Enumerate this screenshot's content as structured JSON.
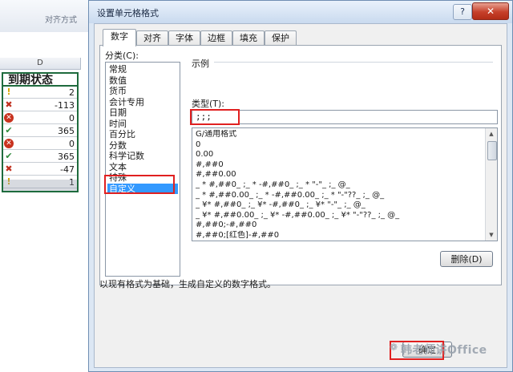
{
  "ribbon": {
    "group_label": "对齐方式"
  },
  "spreadsheet": {
    "column_label": "D",
    "header_cell": "到期状态",
    "rows": [
      {
        "icon": "warning-flag-icon",
        "glyph": "!",
        "value": "2"
      },
      {
        "icon": "red-cross-icon",
        "glyph": "✖",
        "value": "-113"
      },
      {
        "icon": "stop-circle-icon",
        "glyph": "✕",
        "value": "0"
      },
      {
        "icon": "green-check-icon",
        "glyph": "✔",
        "value": "365"
      },
      {
        "icon": "stop-circle-icon",
        "glyph": "✕",
        "value": "0"
      },
      {
        "icon": "green-check-icon",
        "glyph": "✔",
        "value": "365"
      },
      {
        "icon": "red-cross-icon",
        "glyph": "✖",
        "value": "-47"
      },
      {
        "icon": "warning-flag-icon",
        "glyph": "!",
        "value": "1"
      }
    ]
  },
  "dialog": {
    "title": "设置单元格格式",
    "help_label": "?",
    "close_label": "✕",
    "tabs": [
      {
        "label": "数字",
        "active": true
      },
      {
        "label": "对齐",
        "active": false
      },
      {
        "label": "字体",
        "active": false
      },
      {
        "label": "边框",
        "active": false
      },
      {
        "label": "填充",
        "active": false
      },
      {
        "label": "保护",
        "active": false
      }
    ],
    "category_label": "分类(C):",
    "categories": [
      {
        "label": "常规"
      },
      {
        "label": "数值"
      },
      {
        "label": "货币"
      },
      {
        "label": "会计专用"
      },
      {
        "label": "日期"
      },
      {
        "label": "时间"
      },
      {
        "label": "百分比"
      },
      {
        "label": "分数"
      },
      {
        "label": "科学记数"
      },
      {
        "label": "文本"
      },
      {
        "label": "特殊"
      },
      {
        "label": "自定义",
        "selected": true
      }
    ],
    "sample_label": "示例",
    "type_label": "类型(T):",
    "type_value": ";;;",
    "formats": [
      "G/通用格式",
      "0",
      "0.00",
      "#,##0",
      "#,##0.00",
      "_ * #,##0_ ;_ * -#,##0_ ;_ * \"-\"_ ;_ @_",
      "_ * #,##0.00_ ;_ * -#,##0.00_ ;_ * \"-\"??_ ;_ @_",
      "_ ¥* #,##0_ ;_ ¥* -#,##0_ ;_ ¥* \"-\"_ ;_ @_",
      "_ ¥* #,##0.00_ ;_ ¥* -#,##0.00_ ;_ ¥* \"-\"??_ ;_ @_",
      "#,##0;-#,##0",
      "#,##0;[红色]-#,##0"
    ],
    "delete_button": "删除(D)",
    "description": "以现有格式为基础，生成自定义的数字格式。",
    "ok_button": "确定"
  },
  "watermark": "韩老师讲Office",
  "colors": {
    "highlight": "#e02020",
    "selection": "#3399ff",
    "title_bar": "#c9daef"
  }
}
